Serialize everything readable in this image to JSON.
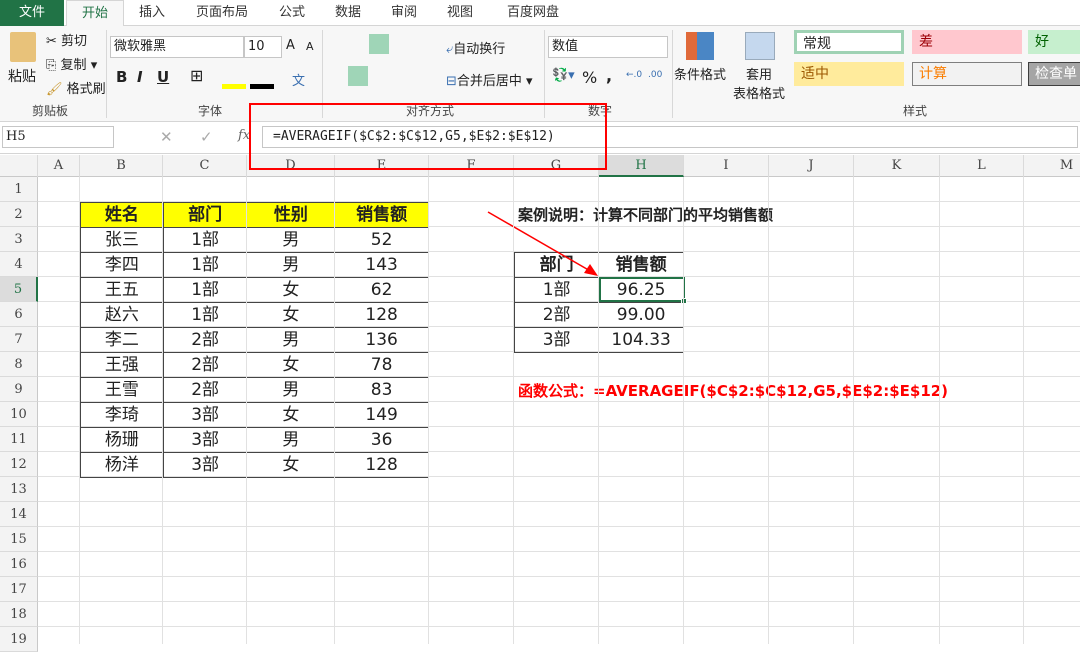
{
  "tabs": [
    "文件",
    "开始",
    "插入",
    "页面布局",
    "公式",
    "数据",
    "审阅",
    "视图",
    "百度网盘"
  ],
  "active_tab": "开始",
  "ribbon": {
    "clipboard": {
      "paste": "粘贴",
      "cut": "剪切",
      "copy": "复制",
      "format_painter": "格式刷",
      "label": "剪贴板"
    },
    "font": {
      "name": "微软雅黑",
      "size": "10",
      "bold": "B",
      "italic": "I",
      "underline": "U",
      "label": "字体",
      "grow": "A",
      "shrink": "A",
      "phonetic": "文"
    },
    "alignment": {
      "wrap": "自动换行",
      "merge": "合并后居中",
      "label": "对齐方式"
    },
    "number": {
      "format": "数值",
      "percent": "%",
      "comma": ",",
      "label": "数字"
    },
    "styles": {
      "conditional": "条件格式",
      "table_format_1": "套用",
      "table_format_2": "表格格式",
      "label": "样式",
      "cells": [
        {
          "t": "常规",
          "bg": "#ffffff",
          "fg": "#222222",
          "bd": "#9fd2b4"
        },
        {
          "t": "差",
          "bg": "#ffc7ce",
          "fg": "#9c0006",
          "bd": "#ffc7ce"
        },
        {
          "t": "好",
          "bg": "#c6efce",
          "fg": "#006100",
          "bd": "#c6efce"
        },
        {
          "t": "适中",
          "bg": "#ffeb9c",
          "fg": "#9c5700",
          "bd": "#ffeb9c"
        },
        {
          "t": "计算",
          "bg": "#f2f2f2",
          "fg": "#fa7d00",
          "bd": "#7f7f7f"
        },
        {
          "t": "检查单",
          "bg": "#a5a5a5",
          "fg": "#ffffff",
          "bd": "#3f3f3f"
        }
      ]
    }
  },
  "formula_bar": {
    "name_box": "H5",
    "fx": "fx",
    "formula": "=AVERAGEIF($C$2:$C$12,G5,$E$2:$E$12)"
  },
  "columns": [
    "A",
    "B",
    "C",
    "D",
    "E",
    "F",
    "G",
    "H",
    "I",
    "J",
    "K",
    "L",
    "M"
  ],
  "rows": [
    "1",
    "2",
    "3",
    "4",
    "5",
    "6",
    "7",
    "8",
    "9",
    "10",
    "11",
    "12",
    "13",
    "14",
    "15",
    "16",
    "17",
    "18",
    "19"
  ],
  "main_table": {
    "headers": [
      "姓名",
      "部门",
      "性别",
      "销售额"
    ],
    "rows": [
      [
        "张三",
        "1部",
        "男",
        "52"
      ],
      [
        "李四",
        "1部",
        "男",
        "143"
      ],
      [
        "王五",
        "1部",
        "女",
        "62"
      ],
      [
        "赵六",
        "1部",
        "女",
        "128"
      ],
      [
        "李二",
        "2部",
        "男",
        "136"
      ],
      [
        "王强",
        "2部",
        "女",
        "78"
      ],
      [
        "王雪",
        "2部",
        "男",
        "83"
      ],
      [
        "李琦",
        "3部",
        "女",
        "149"
      ],
      [
        "杨珊",
        "3部",
        "男",
        "36"
      ],
      [
        "杨洋",
        "3部",
        "女",
        "128"
      ]
    ]
  },
  "summary_table": {
    "headers": [
      "部门",
      "销售额"
    ],
    "rows": [
      [
        "1部",
        "96.25"
      ],
      [
        "2部",
        "99.00"
      ],
      [
        "3部",
        "104.33"
      ]
    ]
  },
  "note": "案例说明：计算不同部门的平均销售额",
  "formula_note": "函数公式：=AVERAGEIF($C$2:$C$12,G5,$E$2:$E$12)",
  "colors": {
    "accent": "#217346",
    "header_yellow": "#ffff00",
    "red": "#ff0000"
  }
}
